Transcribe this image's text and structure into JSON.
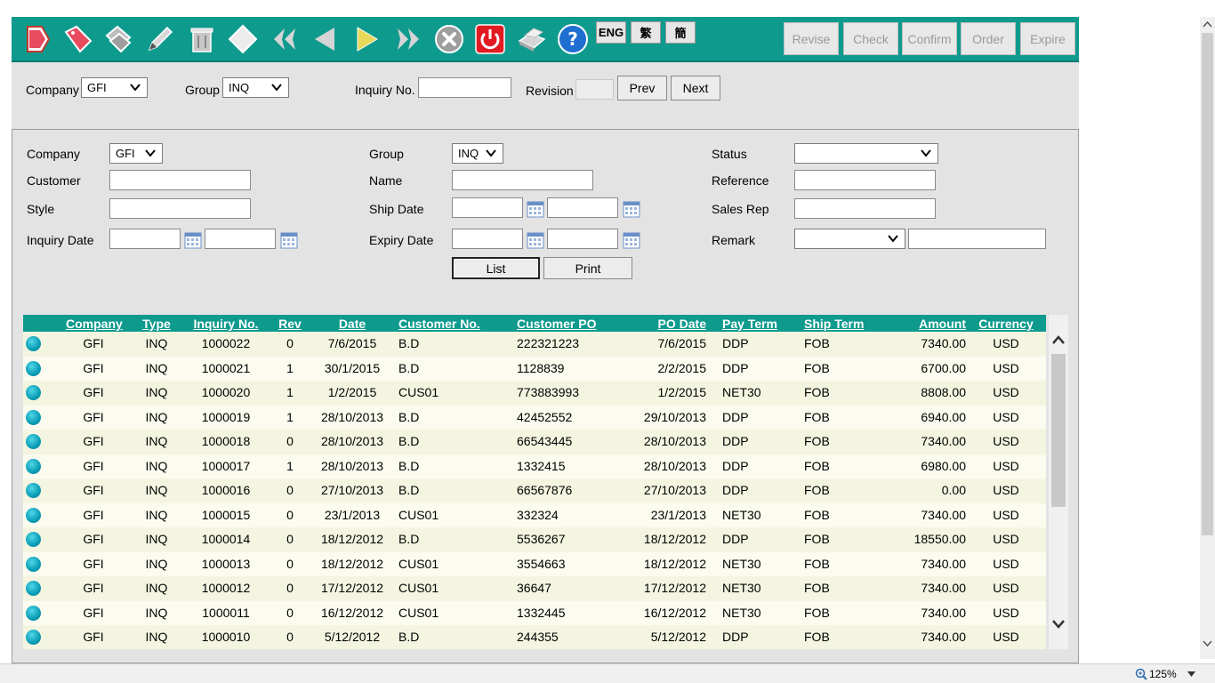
{
  "colors": {
    "toolbar": "#0f9a8e",
    "panel": "#e3e3e3",
    "row_odd": "#f4f5e1",
    "row_even": "#fbfbef"
  },
  "toolbar": {
    "icons": [
      "new-document-icon",
      "tag-icon",
      "copy-icon",
      "pencil-icon",
      "trash-icon",
      "diamond-icon",
      "first-record-icon",
      "previous-record-icon",
      "next-record-icon",
      "last-record-icon",
      "cancel-icon",
      "power-icon",
      "printer-icon",
      "help-icon"
    ],
    "lang": [
      "ENG",
      "繁",
      "簡"
    ],
    "actions": [
      "Revise",
      "Check",
      "Confirm",
      "Order",
      "Expire"
    ]
  },
  "header": {
    "company_label": "Company",
    "company_value": "GFI",
    "group_label": "Group",
    "group_value": "INQ",
    "inquiry_label": "Inquiry No.",
    "inquiry_value": "",
    "revision_label": "Revision",
    "revision_value": "",
    "prev": "Prev",
    "next": "Next"
  },
  "search": {
    "company_label": "Company",
    "company_value": "GFI",
    "customer_label": "Customer",
    "style_label": "Style",
    "inquiry_date_label": "Inquiry Date",
    "group_label": "Group",
    "group_value": "INQ",
    "name_label": "Name",
    "ship_date_label": "Ship Date",
    "expiry_date_label": "Expiry Date",
    "status_label": "Status",
    "status_value": "",
    "reference_label": "Reference",
    "sales_rep_label": "Sales Rep",
    "remark_label": "Remark",
    "remark_value": "",
    "list": "List",
    "print": "Print"
  },
  "table": {
    "columns": [
      "Company",
      "Type",
      "Inquiry No.",
      "Rev",
      "Date",
      "Customer No.",
      "Customer PO",
      "PO Date",
      "Pay Term",
      "Ship Term",
      "Amount",
      "Currency"
    ],
    "rows": [
      [
        "GFI",
        "INQ",
        "1000022",
        "0",
        "7/6/2015",
        "B.D",
        "222321223",
        "7/6/2015",
        "DDP",
        "FOB",
        "7340.00",
        "USD"
      ],
      [
        "GFI",
        "INQ",
        "1000021",
        "1",
        "30/1/2015",
        "B.D",
        "1128839",
        "2/2/2015",
        "DDP",
        "FOB",
        "6700.00",
        "USD"
      ],
      [
        "GFI",
        "INQ",
        "1000020",
        "1",
        "1/2/2015",
        "CUS01",
        "773883993",
        "1/2/2015",
        "NET30",
        "FOB",
        "8808.00",
        "USD"
      ],
      [
        "GFI",
        "INQ",
        "1000019",
        "1",
        "28/10/2013",
        "B.D",
        "42452552",
        "29/10/2013",
        "DDP",
        "FOB",
        "6940.00",
        "USD"
      ],
      [
        "GFI",
        "INQ",
        "1000018",
        "0",
        "28/10/2013",
        "B.D",
        "66543445",
        "28/10/2013",
        "DDP",
        "FOB",
        "7340.00",
        "USD"
      ],
      [
        "GFI",
        "INQ",
        "1000017",
        "1",
        "28/10/2013",
        "B.D",
        "1332415",
        "28/10/2013",
        "DDP",
        "FOB",
        "6980.00",
        "USD"
      ],
      [
        "GFI",
        "INQ",
        "1000016",
        "0",
        "27/10/2013",
        "B.D",
        "66567876",
        "27/10/2013",
        "DDP",
        "FOB",
        "0.00",
        "USD"
      ],
      [
        "GFI",
        "INQ",
        "1000015",
        "0",
        "23/1/2013",
        "CUS01",
        "332324",
        "23/1/2013",
        "NET30",
        "FOB",
        "7340.00",
        "USD"
      ],
      [
        "GFI",
        "INQ",
        "1000014",
        "0",
        "18/12/2012",
        "B.D",
        "5536267",
        "18/12/2012",
        "DDP",
        "FOB",
        "18550.00",
        "USD"
      ],
      [
        "GFI",
        "INQ",
        "1000013",
        "0",
        "18/12/2012",
        "CUS01",
        "3554663",
        "18/12/2012",
        "NET30",
        "FOB",
        "7340.00",
        "USD"
      ],
      [
        "GFI",
        "INQ",
        "1000012",
        "0",
        "17/12/2012",
        "CUS01",
        "36647",
        "17/12/2012",
        "NET30",
        "FOB",
        "7340.00",
        "USD"
      ],
      [
        "GFI",
        "INQ",
        "1000011",
        "0",
        "16/12/2012",
        "CUS01",
        "1332445",
        "16/12/2012",
        "NET30",
        "FOB",
        "7340.00",
        "USD"
      ],
      [
        "GFI",
        "INQ",
        "1000010",
        "0",
        "5/12/2012",
        "B.D",
        "244355",
        "5/12/2012",
        "DDP",
        "FOB",
        "7340.00",
        "USD"
      ]
    ]
  },
  "statusbar": {
    "zoom": "125%"
  }
}
